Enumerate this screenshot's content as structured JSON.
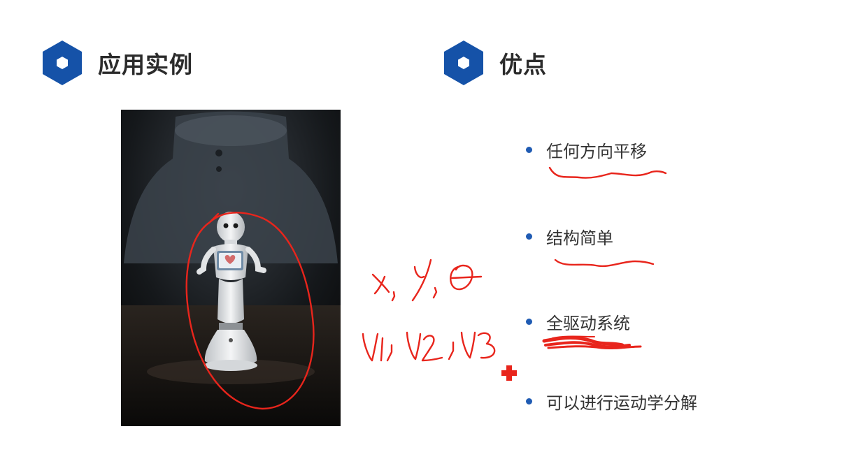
{
  "left_heading": {
    "title": "应用实例",
    "icon": "hexagon-icon"
  },
  "right_heading": {
    "title": "优点",
    "icon": "hexagon-icon"
  },
  "photo": {
    "description": "robot-photo"
  },
  "advantages": [
    "任何方向平移",
    "结构简单",
    "全驱动系统",
    "可以进行运动学分解"
  ],
  "colors": {
    "accent": "#1552a8",
    "ink": "#e8251c",
    "bullet": "#1f5bb3"
  }
}
